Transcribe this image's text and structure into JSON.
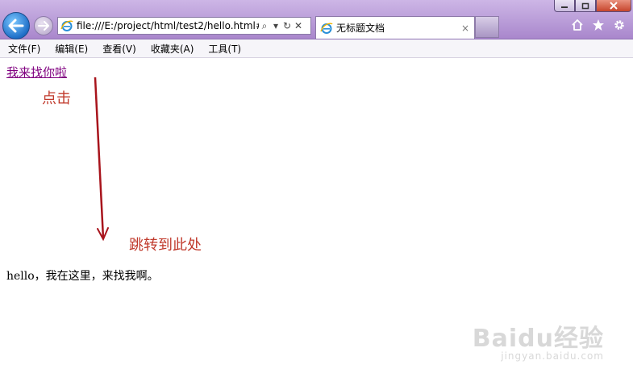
{
  "browser": {
    "address": "file:///E:/project/html/test2/hello.html#",
    "tab_title": "无标题文档",
    "tab_close": "×",
    "search_glyph": "⌕",
    "dropdown_glyph": "▾",
    "refresh_glyph": "↻",
    "stop_glyph": "✕"
  },
  "menu": {
    "items": [
      "文件(F)",
      "编辑(E)",
      "查看(V)",
      "收藏夹(A)",
      "工具(T)"
    ]
  },
  "page": {
    "link_text": "我来找你啦",
    "target_text": "hello，我在这里，来找我啊。"
  },
  "annotations": {
    "click": "点击",
    "jump": "跳转到此处",
    "color": "#c0392b"
  },
  "watermark": {
    "brand": "Baidu经验",
    "url": "jingyan.baidu.com"
  },
  "icons": [
    "back-arrow-icon",
    "forward-arrow-icon",
    "ie-icon",
    "home-icon",
    "star-icon",
    "gear-icon",
    "minimize-icon",
    "maximize-icon",
    "close-icon"
  ]
}
